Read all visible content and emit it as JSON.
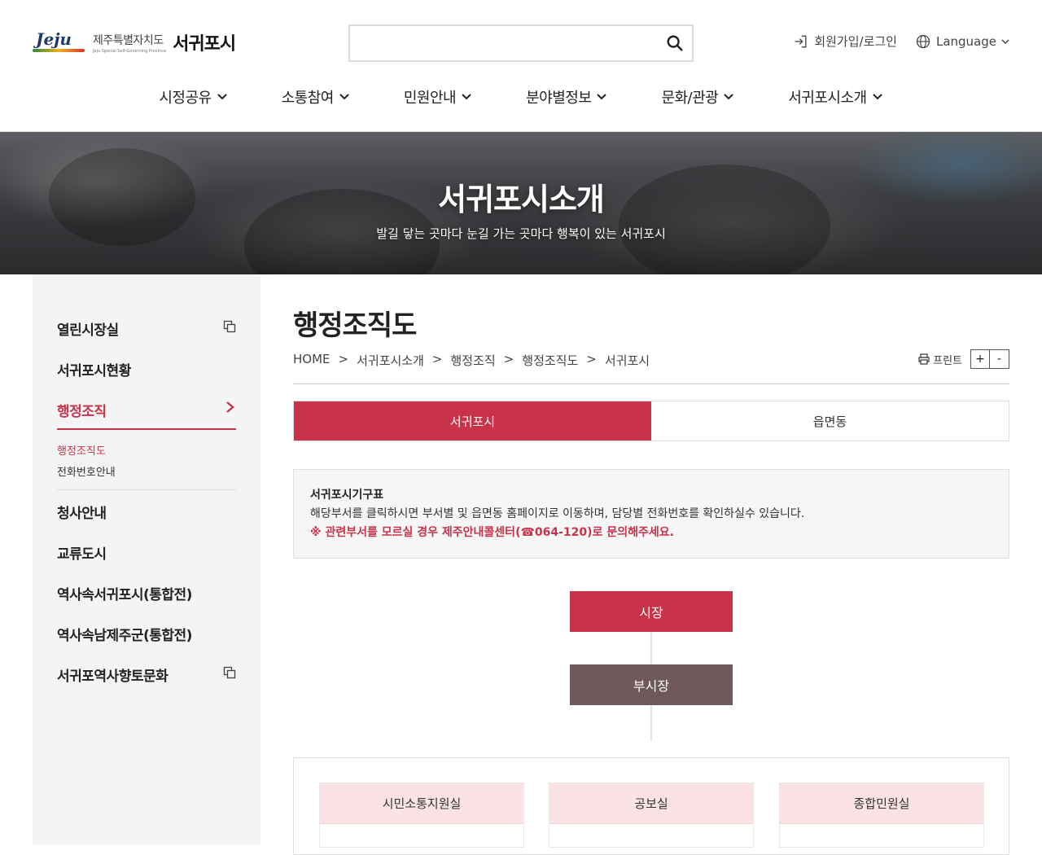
{
  "header": {
    "logo_brand": "Jeju",
    "logo_province_ko": "제주특별자치도",
    "logo_province_en": "Jeju Special Self-Governing Province",
    "logo_city": "서귀포시",
    "search_placeholder": "",
    "login_label": "회원가입/로그인",
    "language_label": "Language"
  },
  "gnb": [
    {
      "label": "시정공유"
    },
    {
      "label": "소통참여"
    },
    {
      "label": "민원안내"
    },
    {
      "label": "분야별정보"
    },
    {
      "label": "문화/관광"
    },
    {
      "label": "서귀포시소개"
    }
  ],
  "banner": {
    "title": "서귀포시소개",
    "subtitle": "발길 닿는 곳마다 눈길 가는 곳마다 행복이 있는 서귀포시"
  },
  "sidebar": {
    "items": [
      {
        "label": "열린시장실",
        "external": true
      },
      {
        "label": "서귀포시현황"
      },
      {
        "label": "행정조직",
        "active": true
      },
      {
        "label": "청사안내"
      },
      {
        "label": "교류도시"
      },
      {
        "label": "역사속서귀포시(통합전)"
      },
      {
        "label": "역사속남제주군(통합전)"
      },
      {
        "label": "서귀포역사향토문화",
        "external": true
      }
    ],
    "sub_items": [
      {
        "label": "행정조직도",
        "active": true
      },
      {
        "label": "전화번호안내"
      }
    ]
  },
  "content": {
    "page_title": "행정조직도",
    "breadcrumb": [
      "HOME",
      "서귀포시소개",
      "행정조직",
      "행정조직도",
      "서귀포시"
    ],
    "print_label": "프린트",
    "zoom_in": "+",
    "zoom_out": "-",
    "tabs": [
      {
        "label": "서귀포시",
        "active": true
      },
      {
        "label": "읍면동"
      }
    ],
    "info": {
      "title": "서귀포시기구표",
      "desc": "해당부서를 클릭하시면 부서별 및 읍면동 홈페이지로 이동하며, 담당별 전화번호를 확인하실수 있습니다.",
      "warning": "※ 관련부서를 모르실 경우 제주안내콜센터(☎064-120)로 문의해주세요."
    },
    "org": {
      "mayor": "시장",
      "vice_mayor": "부시장",
      "departments": [
        "시민소통지원실",
        "공보실",
        "종합민원실"
      ]
    }
  },
  "colors": {
    "accent": "#c8334a",
    "vice_mayor": "#6e585a",
    "dept_head": "#fbe3e5",
    "sidebar_bg": "#f4f4f4"
  }
}
